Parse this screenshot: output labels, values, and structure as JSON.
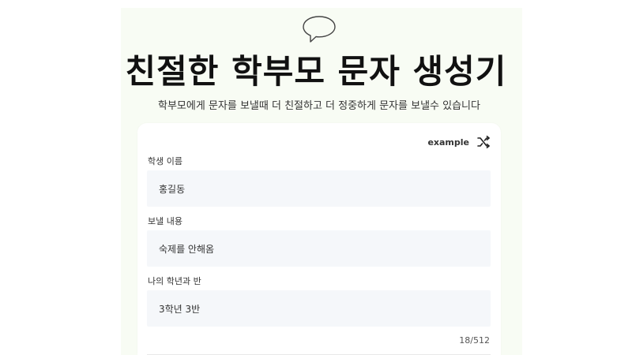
{
  "header": {
    "icon": "chat-bubble-icon",
    "title": "친절한 학부모 문자 생성기",
    "subtitle": "학부모에게 문자를 보낼때 더 친절하고 더 정중하게 문자를 보낼수 있습니다"
  },
  "form": {
    "example_label": "example",
    "example_icon": "shuffle-icon",
    "fields": [
      {
        "label": "학생 이름",
        "value": "홍길동"
      },
      {
        "label": "보낼 내용",
        "value": "숙제를 안해옴"
      },
      {
        "label": "나의 학년과 반",
        "value": "3학년 3반"
      }
    ],
    "counter": "18/512"
  },
  "colors": {
    "background_tint": "#f8fcf4",
    "input_background": "#f5f7fa",
    "title_text": "#111111"
  }
}
